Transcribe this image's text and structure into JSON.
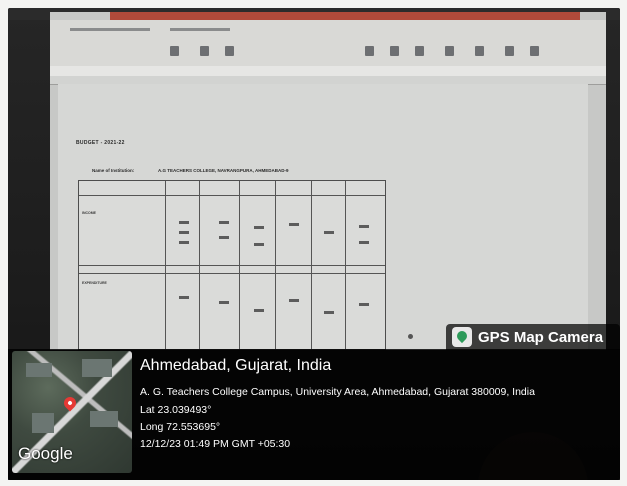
{
  "document": {
    "title": "BUDGET - 2021-22",
    "institution_label": "Name of Institution:",
    "institution_name": "A.G TEACHERS COLLEGE, NAVRANGPURA, AHMEDABAD-9",
    "section_income": "INCOME",
    "section_expenditure": "EXPENDITURE"
  },
  "overlay": {
    "badge_label": "GPS Map Camera",
    "city": "Ahmedabad, Gujarat, India",
    "address": "A. G. Teachers College Campus, University Area, Ahmedabad, Gujarat 380009, India",
    "latitude": "Lat 23.039493°",
    "longitude": "Long 72.553695°",
    "datetime": "12/12/23 01:49 PM GMT +05:30",
    "map_brand": "Google"
  },
  "colors": {
    "accent_pin": "#e53935",
    "badge_icon": "#2d9a5a"
  }
}
